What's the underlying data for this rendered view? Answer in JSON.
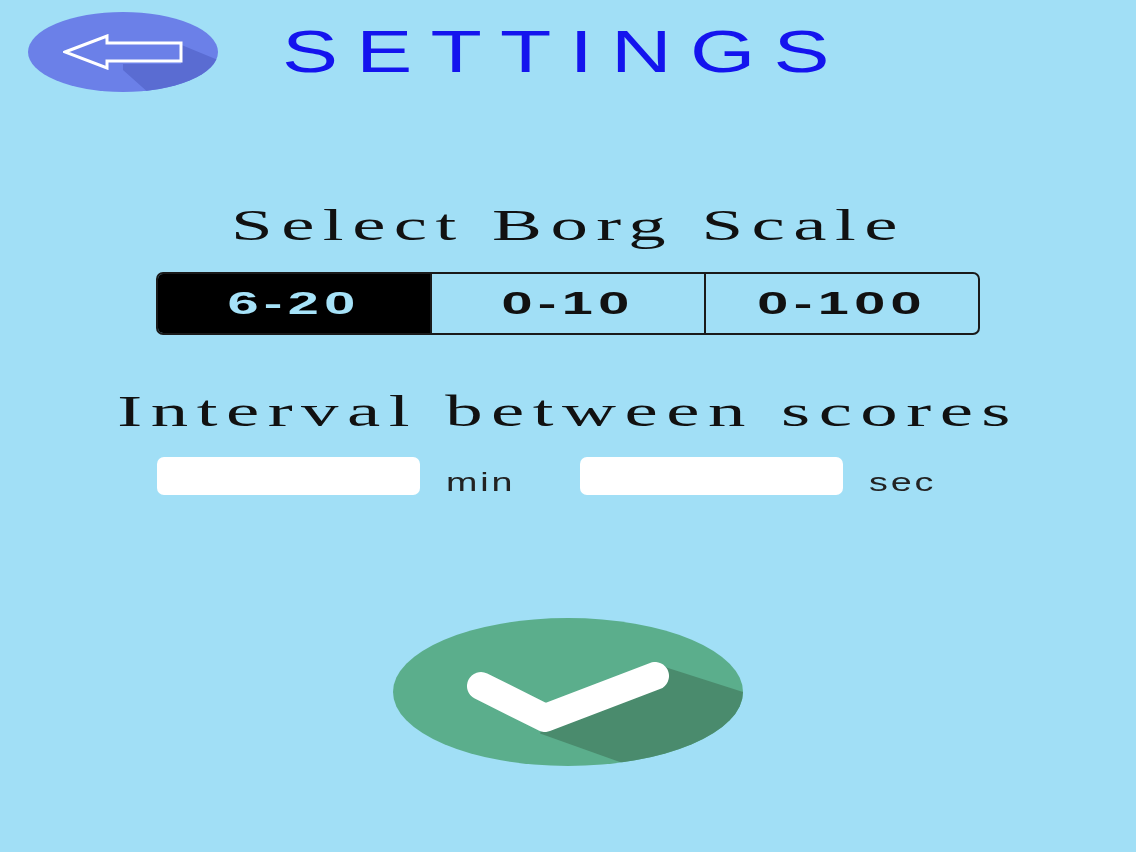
{
  "header": {
    "title": "SETTINGS"
  },
  "scale_section": {
    "title": "Select Borg Scale",
    "options": [
      {
        "label": "6-20",
        "selected": true
      },
      {
        "label": "0-10",
        "selected": false
      },
      {
        "label": "0-100",
        "selected": false
      }
    ]
  },
  "interval_section": {
    "title": "Interval between scores",
    "fields": [
      {
        "unit": "min"
      },
      {
        "unit": "sec"
      }
    ]
  }
}
